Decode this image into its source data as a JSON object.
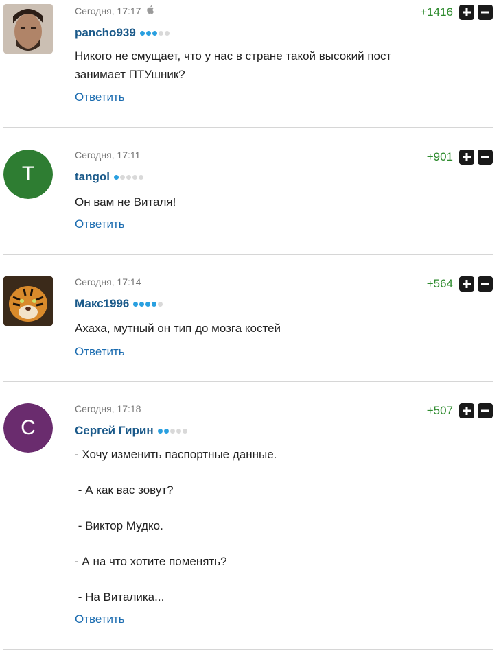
{
  "comments": [
    {
      "time": "Сегодня, 17:17",
      "platform_icon": "apple-icon",
      "author": "pancho939",
      "level": 3,
      "score": "+1416",
      "avatar_color": "#8a6a55",
      "text": [
        "Никого не смущает, что у нас в стране такой высокий пост",
        "занимает ПТУшник?"
      ],
      "reply": "Ответить"
    },
    {
      "time": "Сегодня, 17:11",
      "author": "tangol",
      "level": 1,
      "score": "+901",
      "avatar_letter": "T",
      "avatar_color": "#2e7d32",
      "text": [
        "Он вам не Виталя!"
      ],
      "reply": "Ответить"
    },
    {
      "time": "Сегодня, 17:14",
      "author": "Макс1996",
      "level": 4,
      "score": "+564",
      "avatar_color": "#b5651d",
      "text": [
        "Ахаха, мутный он тип до мозга костей"
      ],
      "reply": "Ответить"
    },
    {
      "time": "Сегодня, 17:18",
      "author": "Сергей Гирин",
      "level": 2,
      "score": "+507",
      "avatar_letter": "С",
      "avatar_color": "#6a2c6e",
      "text": [
        "- Хочу изменить паспортные данные.",
        " - А как вас зовут?",
        " - Виктор Мудко.",
        "- А на что хотите поменять?",
        " - На Виталика..."
      ],
      "reply": "Ответить"
    }
  ]
}
